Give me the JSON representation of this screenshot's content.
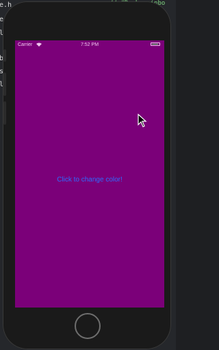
{
  "editor": {
    "line_fragments": [
      "e.h",
      "e.",
      "le",
      "ba",
      "s",
      "le"
    ],
    "top_code": "// #Bush rainbo"
  },
  "simulator": {
    "status_bar": {
      "carrier": "Carrier",
      "time": "7:52 PM",
      "battery_level": 0.85
    },
    "screen": {
      "background_color": "#7b0079",
      "button_label": "Click to change color!",
      "button_color": "#2f6bff"
    }
  },
  "icons": {
    "wifi": "wifi-icon",
    "battery": "battery-icon",
    "cursor": "mouse-pointer-icon"
  }
}
